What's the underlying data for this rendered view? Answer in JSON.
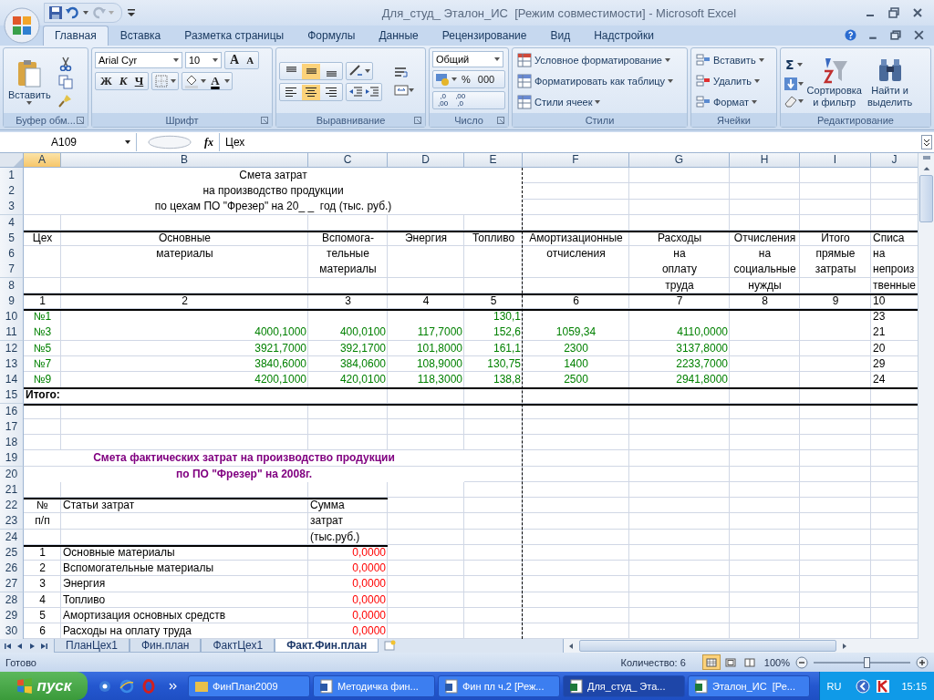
{
  "window": {
    "title": "Для_студ_ Эталон_ИС  [Режим совместимости] - Microsoft Excel"
  },
  "ribbon_tabs": [
    {
      "label": "Главная",
      "selected": true
    },
    {
      "label": "Вставка",
      "selected": false
    },
    {
      "label": "Разметка страницы",
      "selected": false
    },
    {
      "label": "Формулы",
      "selected": false
    },
    {
      "label": "Данные",
      "selected": false
    },
    {
      "label": "Рецензирование",
      "selected": false
    },
    {
      "label": "Вид",
      "selected": false
    },
    {
      "label": "Надстройки",
      "selected": false
    }
  ],
  "ribbon": {
    "clipboard": {
      "label": "Буфер обм...",
      "paste": "Вставить"
    },
    "font": {
      "label": "Шрифт",
      "name": "Arial Cyr",
      "size": "10",
      "grow": "A",
      "shrink": "A",
      "bold": "Ж",
      "italic": "К",
      "underline": "Ч",
      "font_color_button": "A"
    },
    "alignment": {
      "label": "Выравнивание",
      "vertical": [
        {
          "selected": false
        },
        {
          "selected": true
        },
        {
          "selected": false
        }
      ],
      "horizontal": [
        {
          "selected": false
        },
        {
          "selected": true
        },
        {
          "selected": false
        }
      ]
    },
    "number": {
      "label": "Число",
      "format": "Общий",
      "percent": "%",
      "thousands": "000",
      "decimals": [
        {
          "top": ",0",
          "bottom": ",00"
        },
        {
          "top": ",00",
          "bottom": ",0"
        }
      ]
    },
    "styles": {
      "label": "Стили",
      "items": [
        "Условное форматирование",
        "Форматировать как таблицу",
        "Стили ячеек"
      ]
    },
    "cells": {
      "label": "Ячейки",
      "items": [
        "Вставить",
        "Удалить",
        "Формат"
      ]
    },
    "editing": {
      "label": "Редактирование",
      "sum": "Σ",
      "sort": [
        "Сортировка",
        "и фильтр"
      ],
      "find": [
        "Найти и",
        "выделить"
      ]
    }
  },
  "formula_bar": {
    "name_box": "A109",
    "fx": "fx",
    "content": "Цех"
  },
  "sheet": {
    "columns": [
      {
        "label": "A",
        "selected": true
      },
      {
        "label": "B",
        "selected": false
      },
      {
        "label": "C",
        "selected": false
      },
      {
        "label": "D",
        "selected": false
      },
      {
        "label": "E",
        "selected": false
      },
      {
        "label": "F",
        "selected": false
      },
      {
        "label": "G",
        "selected": false
      },
      {
        "label": "H",
        "selected": false
      },
      {
        "label": "I",
        "selected": false
      },
      {
        "label": "J",
        "selected": false
      }
    ],
    "rows": [
      {
        "number": "1",
        "kind": "title",
        "ruled": false,
        "cells": [
          "Смета затрат"
        ]
      },
      {
        "number": "2",
        "kind": "title",
        "ruled": false,
        "cells": [
          "на производство продукции"
        ]
      },
      {
        "number": "3",
        "kind": "title",
        "ruled": false,
        "cells": [
          "по цехам ПО \"Фрезер\" на 20_ _  год (тыс. руб.)"
        ]
      },
      {
        "number": "4",
        "ruled": false
      },
      {
        "number": "5",
        "kind": "header",
        "ruled": true,
        "cells": [
          "Цех",
          "Основные",
          "Вспомога-",
          "Энергия",
          "Топливо",
          "Амортизационные",
          "Расходы",
          "Отчисления",
          "Итого",
          "Списа"
        ]
      },
      {
        "number": "6",
        "kind": "header",
        "ruled": false,
        "cells": [
          "",
          "материалы",
          "тельные",
          "",
          "",
          "отчисления",
          "на",
          "на",
          "прямые",
          "на"
        ]
      },
      {
        "number": "7",
        "kind": "header",
        "ruled": false,
        "cells": [
          "",
          "",
          "материалы",
          "",
          "",
          "",
          "оплату",
          "социальные",
          "затраты",
          "непроиз"
        ]
      },
      {
        "number": "8",
        "kind": "header",
        "ruled": false,
        "cells": [
          "",
          "",
          "",
          "",
          "",
          "",
          "труда",
          "нужды",
          "",
          "твенные"
        ]
      },
      {
        "number": "9",
        "kind": "header",
        "ruled": true,
        "cells": [
          "1",
          "2",
          "3",
          "4",
          "5",
          "6",
          "7",
          "8",
          "9",
          "10"
        ]
      },
      {
        "number": "10",
        "kind": "data",
        "ruled": true,
        "cells": [
          "№1",
          "",
          "",
          "",
          "130,1",
          "",
          "",
          "",
          "",
          "23"
        ]
      },
      {
        "number": "11",
        "kind": "data",
        "ruled": false,
        "cells": [
          "№3",
          "4000,1000",
          "400,0100",
          "117,7000",
          "152,6",
          "1059,34",
          "4110,0000",
          "",
          "",
          "21"
        ]
      },
      {
        "number": "12",
        "kind": "data",
        "ruled": false,
        "cells": [
          "№5",
          "3921,7000",
          "392,1700",
          "101,8000",
          "161,1",
          "2300",
          "3137,8000",
          "",
          "",
          "20"
        ]
      },
      {
        "number": "13",
        "kind": "data",
        "ruled": false,
        "cells": [
          "№7",
          "3840,6000",
          "384,0600",
          "108,9000",
          "130,75",
          "1400",
          "2233,7000",
          "",
          "",
          "29"
        ]
      },
      {
        "number": "14",
        "kind": "data",
        "ruled": false,
        "cells": [
          "№9",
          "4200,1000",
          "420,0100",
          "118,3000",
          "138,8",
          "2500",
          "2941,8000",
          "",
          "",
          "24"
        ]
      },
      {
        "number": "15",
        "kind": "total",
        "ruled": true,
        "cells": [
          "Итого:"
        ]
      },
      {
        "number": "16",
        "ruled": true
      },
      {
        "number": "17",
        "ruled": false
      },
      {
        "number": "18",
        "ruled": false
      },
      {
        "number": "19",
        "kind": "subtitle",
        "ruled": false,
        "cells": [
          "Смета фактических затрат на производство продукции"
        ]
      },
      {
        "number": "20",
        "kind": "subtitle",
        "ruled": false,
        "cells": [
          "по ПО \"Фрезер\" на 2008г."
        ]
      },
      {
        "number": "21",
        "ruled": false
      },
      {
        "number": "22",
        "kind": "list_header",
        "ruled": true,
        "cells": [
          "№",
          "Статьи затрат",
          "Сумма"
        ]
      },
      {
        "number": "23",
        "kind": "list_header",
        "ruled": false,
        "cells": [
          "п/п",
          "",
          "затрат"
        ]
      },
      {
        "number": "24",
        "kind": "list_header",
        "ruled": false,
        "cells": [
          "",
          "",
          "(тыс.руб.)"
        ]
      },
      {
        "number": "25",
        "kind": "list_item",
        "ruled": true,
        "cells": [
          "1",
          "Основные материалы",
          "0,0000"
        ]
      },
      {
        "number": "26",
        "kind": "list_item",
        "ruled": false,
        "cells": [
          "2",
          "Вспомогательные материалы",
          "0,0000"
        ]
      },
      {
        "number": "27",
        "kind": "list_item",
        "ruled": false,
        "cells": [
          "3",
          "Энергия",
          "0,0000"
        ]
      },
      {
        "number": "28",
        "kind": "list_item",
        "ruled": false,
        "cells": [
          "4",
          "Топливо",
          "0,0000"
        ]
      },
      {
        "number": "29",
        "kind": "list_item",
        "ruled": false,
        "cells": [
          "5",
          "Амортизация основных средств",
          "0,0000"
        ]
      },
      {
        "number": "30",
        "kind": "list_item",
        "ruled": false,
        "cells": [
          "6",
          "Расходы на оплату труда",
          "0,0000"
        ]
      }
    ]
  },
  "sheet_tabs": [
    {
      "label": "ПланЦех1",
      "selected": false
    },
    {
      "label": "Фин.план",
      "selected": false
    },
    {
      "label": "ФактЦех1",
      "selected": false
    },
    {
      "label": "Факт.Фин.план",
      "selected": true
    }
  ],
  "status_bar": {
    "text": "Готово",
    "count": "Количество: 6",
    "views": [
      {
        "selected": true
      },
      {
        "selected": false
      },
      {
        "selected": false
      }
    ],
    "zoom": {
      "reading": "100%",
      "level": 0.55
    }
  },
  "taskbar": {
    "start": "пуск",
    "tasks": [
      {
        "kind": "folder",
        "label": "ФинПлан2009",
        "selected": false
      },
      {
        "kind": "word",
        "label": "Методичка фин...",
        "selected": false
      },
      {
        "kind": "word",
        "label": "Фин пл ч.2 [Реж...",
        "selected": false
      },
      {
        "kind": "excel",
        "label": "Для_студ_ Эта...",
        "selected": true
      },
      {
        "kind": "excel",
        "label": "Эталон_ИС  [Ре...",
        "selected": false
      }
    ],
    "language": "RU",
    "time": "15:15"
  }
}
